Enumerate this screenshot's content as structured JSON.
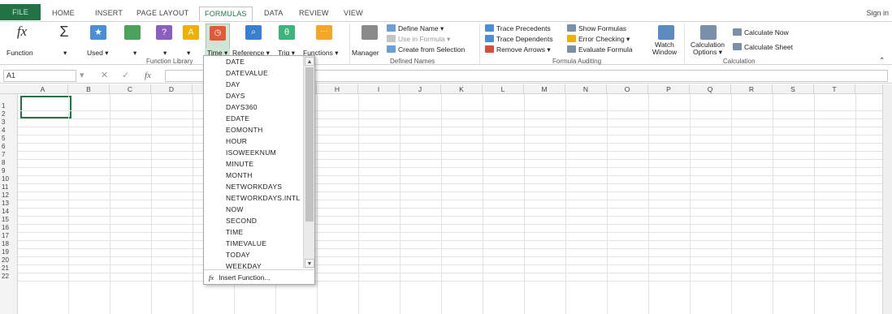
{
  "tabs": [
    "FILE",
    "HOME",
    "INSERT",
    "PAGE LAYOUT",
    "FORMULAS",
    "DATA",
    "REVIEW",
    "VIEW"
  ],
  "active_tab": "FORMULAS",
  "signin": "Sign in",
  "ribbon": {
    "fx_label": "Insert Function",
    "autosum": "AutoSum",
    "recently_used": "Recently Used",
    "financial": "Financial",
    "logical": "Logical",
    "text": "Text",
    "date_time": "Date & Time",
    "lookup": "Lookup & Reference",
    "math_trig": "Math & Trig",
    "more_functions": "More Functions",
    "group_function_library": "Function Library",
    "name_manager": "Name Manager",
    "define_name": "Define Name",
    "use_in_formula": "Use in Formula",
    "create_from_selection": "Create from Selection",
    "group_defined_names": "Defined Names",
    "trace_precedents": "Trace Precedents",
    "trace_dependents": "Trace Dependents",
    "remove_arrows": "Remove Arrows",
    "show_formulas": "Show Formulas",
    "error_checking": "Error Checking",
    "evaluate_formula": "Evaluate Formula",
    "group_formula_auditing": "Formula Auditing",
    "watch_window": "Watch Window",
    "calc_options": "Calculation Options",
    "calculate_now": "Calculate Now",
    "calculate_sheet": "Calculate Sheet",
    "group_calculation": "Calculation",
    "lower_labels": {
      "function": "Function",
      "used": "Used",
      "time": "Time",
      "reference": "Reference",
      "trig": "Trig",
      "functions": "Functions",
      "manager": "Manager",
      "window": "Window",
      "options": "Options"
    }
  },
  "namebox": "A1",
  "columns": [
    "A",
    "B",
    "C",
    "D",
    "E",
    "F",
    "G",
    "H",
    "I",
    "J",
    "K",
    "L",
    "M",
    "N",
    "O",
    "P",
    "Q",
    "R",
    "S",
    "T"
  ],
  "rows": [
    "1",
    "2",
    "3",
    "4",
    "5",
    "6",
    "7",
    "8",
    "9",
    "10",
    "11",
    "12",
    "13",
    "14",
    "15",
    "16",
    "17",
    "18",
    "19",
    "20",
    "21",
    "22"
  ],
  "dropdown": {
    "items": [
      "DATE",
      "DATEVALUE",
      "DAY",
      "DAYS",
      "DAYS360",
      "EDATE",
      "EOMONTH",
      "HOUR",
      "ISOWEEKNUM",
      "MINUTE",
      "MONTH",
      "NETWORKDAYS",
      "NETWORKDAYS.INTL",
      "NOW",
      "SECOND",
      "TIME",
      "TIMEVALUE",
      "TODAY",
      "WEEKDAY"
    ],
    "footer": "Insert Function..."
  },
  "colors": {
    "accent": "#217346"
  }
}
